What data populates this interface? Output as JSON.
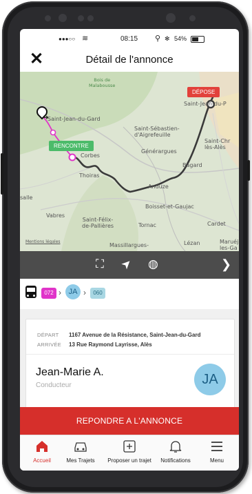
{
  "status": {
    "carrier": "●●●○○",
    "wifi": "≋",
    "time": "08:15",
    "location": "⚲",
    "bluetooth": "✻",
    "battery_pct": "54%"
  },
  "nav": {
    "close": "✕",
    "title": "Détail de l'annonce"
  },
  "map": {
    "labels": {
      "forest": "Bois de\nMalabousse",
      "st_jean": "Saint-Jean-du-Gard",
      "st_jean_right": "Saint-Jean-du-P",
      "st_sebastien": "Saint-Sébastien-\nd'Aigrefeuille",
      "generargues": "Générargues",
      "saint_chr": "Saint-Chr\nlès-Alès",
      "corbes": "Corbes",
      "thoiras": "Thoiras",
      "bagard": "Bagard",
      "anduze": "Anduze",
      "salle": "salle",
      "boisset": "Boisset-et-Gaujac",
      "vabres": "Vabres",
      "st_felix": "Saint-Félix-\nde-Pallières",
      "tornac": "Tornac",
      "cardet": "Cardet",
      "mentions": "Mentions légales",
      "massillargues": "Massillargues-",
      "lezan": "Lézan",
      "maruej": "Maruéj\nles-Ga"
    },
    "depose_label": "DÉPOSE",
    "rencontre_label": "RENCONTRE",
    "colors": {
      "depose": "#e2413b",
      "rencontre": "#4cbb6a",
      "route": "#3a3a3a",
      "walk": "#e035c9"
    }
  },
  "map_toolbar": {
    "icons": [
      "fullscreen-icon",
      "navigate-icon",
      "globe-icon",
      "chevron-right-icon"
    ],
    "glyphs": {
      "fullscreen": "⛶",
      "navigate": "➤",
      "globe": "◍",
      "next": "❯"
    }
  },
  "route_strip": {
    "bus_glyph": "🚌",
    "line1": "072",
    "initials": "JA",
    "line2": "060",
    "arrow": "›"
  },
  "trip": {
    "depart_label": "DÉPART",
    "depart_value": "1167 Avenue de la Résistance, Saint-Jean-du-Gard",
    "arrivee_label": "ARRIVÉE",
    "arrivee_value": "13 Rue Raymond Layrisse, Alès"
  },
  "driver": {
    "name": "Jean-Marie A.",
    "role": "Conducteur",
    "initials": "JA"
  },
  "reply_button": "REPONDRE A L'ANNONCE",
  "tabs": [
    {
      "label": "Accueil",
      "icon": "home-icon",
      "active": true
    },
    {
      "label": "Mes Trajets",
      "icon": "car-icon",
      "active": false
    },
    {
      "label": "Proposer un trajet",
      "icon": "plus-box-icon",
      "active": false
    },
    {
      "label": "Notifications",
      "icon": "bell-icon",
      "active": false
    },
    {
      "label": "Menu",
      "icon": "menu-icon",
      "active": false
    }
  ],
  "accent_color": "#d62f2b"
}
